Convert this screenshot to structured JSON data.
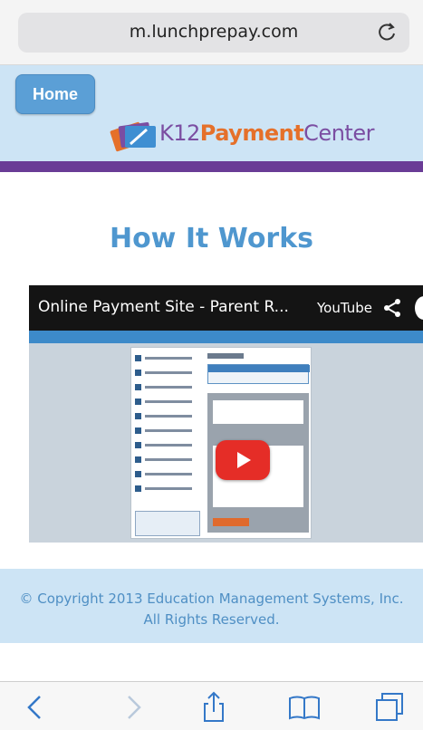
{
  "browser": {
    "url": "m.lunchprepay.com",
    "reload_icon": "reload-icon"
  },
  "header": {
    "home_label": "Home",
    "logo": {
      "k12": "K12",
      "payment": "Payment",
      "center": "Center"
    }
  },
  "main": {
    "title": "How It Works",
    "video": {
      "title": "Online Payment Site - Parent R...",
      "provider": "YouTube",
      "share_icon": "share-icon",
      "play_icon": "play-icon"
    }
  },
  "footer": {
    "copyright": "© Copyright 2013 Education Management Systems, Inc. All Rights Reserved."
  },
  "toolbar": {
    "icons": [
      "back-icon",
      "forward-icon",
      "share-icon",
      "bookmarks-icon",
      "tabs-icon"
    ]
  },
  "colors": {
    "header_bg": "#cde4f5",
    "accent_purple": "#6a3c96",
    "title_blue": "#4f97cf",
    "home_button": "#5b9fd6",
    "youtube_red": "#e52d27"
  }
}
